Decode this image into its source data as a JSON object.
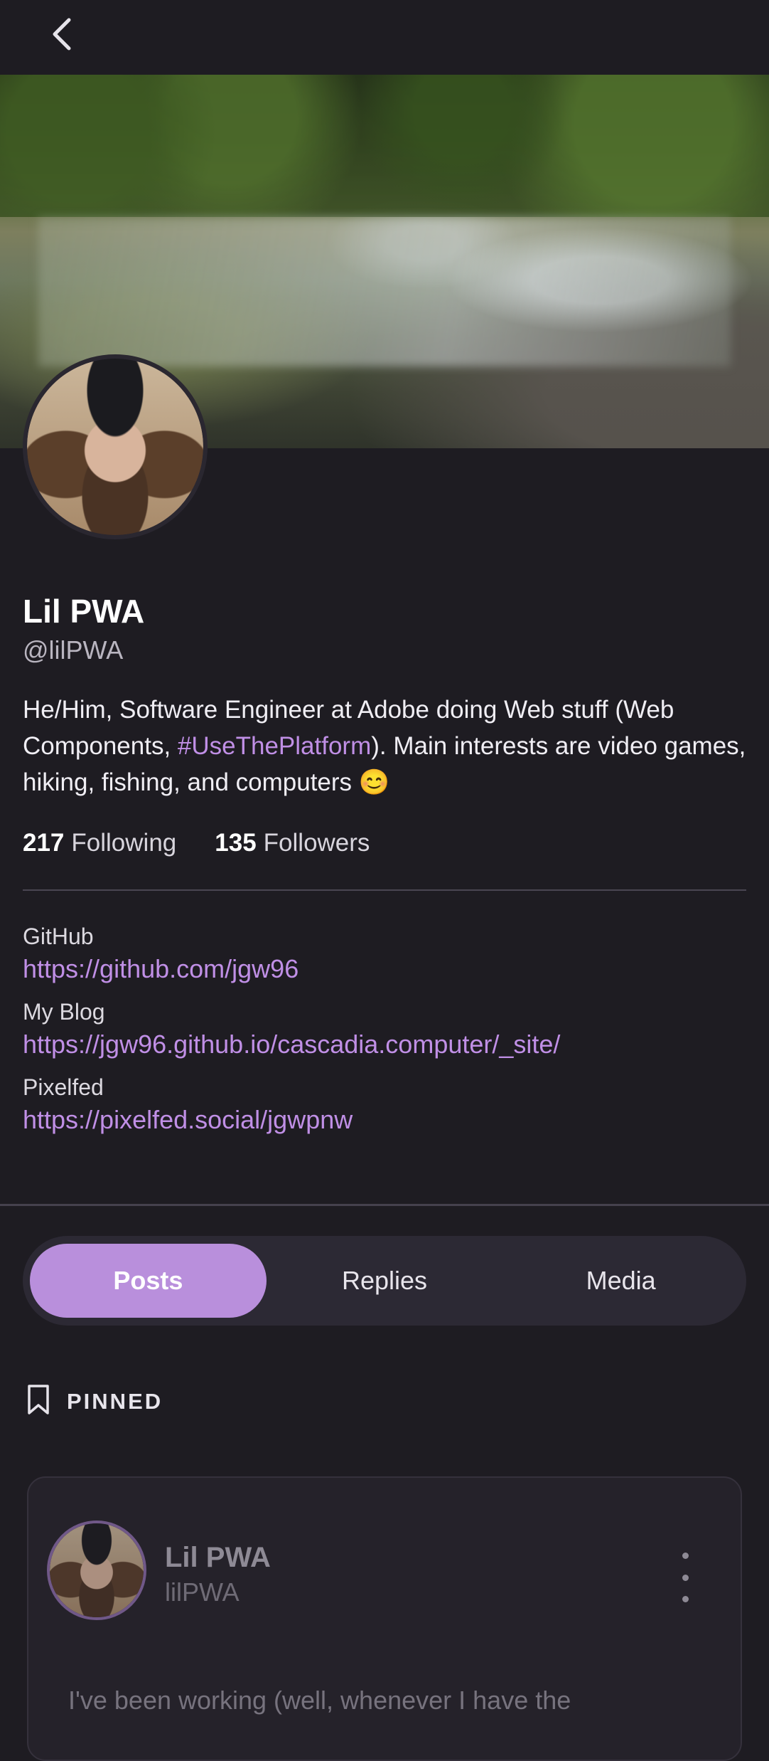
{
  "header": {
    "back_icon": "chevron-left-icon"
  },
  "banner": {
    "description_icon": "banner-image"
  },
  "profile": {
    "display_name": "Lil PWA",
    "handle": "@lilPWA",
    "bio_part1": "He/Him, Software Engineer at Adobe doing Web stuff (Web Components, ",
    "bio_hashtag": "#UseThePlatform",
    "bio_part2": "). Main interests are video games, hiking, fishing, and computers 😊",
    "following_count": "217",
    "following_label": "Following",
    "followers_count": "135",
    "followers_label": "Followers"
  },
  "links": [
    {
      "label": "GitHub",
      "url": "https://github.com/jgw96"
    },
    {
      "label": "My Blog",
      "url": "https://jgw96.github.io/cascadia.computer/_site/"
    },
    {
      "label": "Pixelfed",
      "url": "https://pixelfed.social/jgwpnw"
    }
  ],
  "tabs": [
    {
      "label": "Posts",
      "active": true
    },
    {
      "label": "Replies",
      "active": false
    },
    {
      "label": "Media",
      "active": false
    }
  ],
  "pinned": {
    "icon": "bookmark-icon",
    "label": "PINNED"
  },
  "post": {
    "author_name": "Lil PWA",
    "author_handle": "lilPWA",
    "text_preview": "I've been working (well, whenever I have the",
    "menu_icon": "more-vertical-icon"
  },
  "colors": {
    "background": "#1e1c22",
    "accent": "#b98fdc",
    "link": "#c08fe6"
  }
}
